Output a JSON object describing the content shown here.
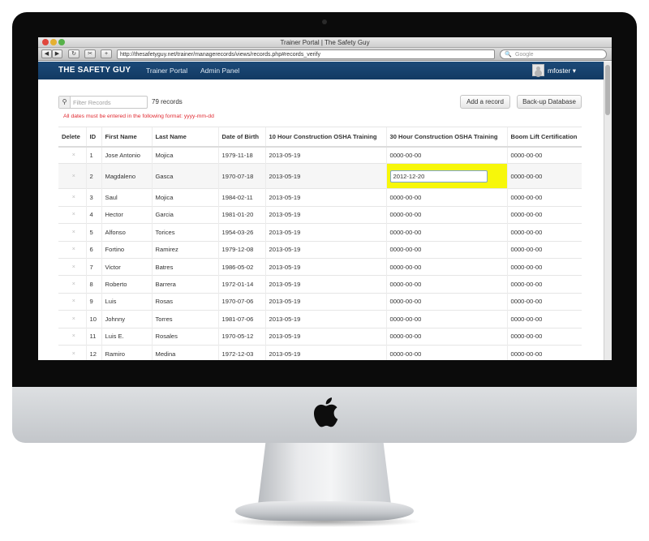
{
  "window": {
    "title": "Trainer Portal | The Safety Guy",
    "url": "http://thesafetyguy.net/trainer/managerecords/views/records.php#records_verify",
    "search_placeholder": "Google",
    "toolbar_buttons": [
      "◀",
      "▶",
      "↻",
      "✂",
      "+"
    ]
  },
  "navbar": {
    "brand": "THE SAFETY GUY",
    "links": [
      "Trainer Portal",
      "Admin Panel"
    ],
    "user": "mfoster",
    "brand_color": "#1c4a78"
  },
  "controls": {
    "filter_placeholder": "Filter Records",
    "record_count": "79 records",
    "add_record": "Add a record",
    "backup": "Back-up Database",
    "date_note": "All dates must be entered in the following format: yyyy-mm-dd"
  },
  "table": {
    "headers": [
      "Delete",
      "ID",
      "First Name",
      "Last Name",
      "Date of Birth",
      "10 Hour Construction OSHA Training",
      "30 Hour Construction OSHA Training",
      "Boom Lift Certification"
    ],
    "delete_glyph": "×",
    "rows": [
      {
        "id": "1",
        "first": "Jose Antonio",
        "last": "Mojica",
        "dob": "1979-11-18",
        "osha10": "2013-05-19",
        "osha30": "0000-00-00",
        "boom": "0000-00-00"
      },
      {
        "id": "2",
        "first": "Magdaleno",
        "last": "Gasca",
        "dob": "1970-07-18",
        "osha10": "2013-05-19",
        "osha30": "2012-12-20",
        "boom": "0000-00-00"
      },
      {
        "id": "3",
        "first": "Saul",
        "last": "Mojica",
        "dob": "1984-02-11",
        "osha10": "2013-05-19",
        "osha30": "0000-00-00",
        "boom": "0000-00-00"
      },
      {
        "id": "4",
        "first": "Hector",
        "last": "Garcia",
        "dob": "1981-01-20",
        "osha10": "2013-05-19",
        "osha30": "0000-00-00",
        "boom": "0000-00-00"
      },
      {
        "id": "5",
        "first": "Alfonso",
        "last": "Torices",
        "dob": "1954-03-26",
        "osha10": "2013-05-19",
        "osha30": "0000-00-00",
        "boom": "0000-00-00"
      },
      {
        "id": "6",
        "first": "Fortino",
        "last": "Ramirez",
        "dob": "1979-12-08",
        "osha10": "2013-05-19",
        "osha30": "0000-00-00",
        "boom": "0000-00-00"
      },
      {
        "id": "7",
        "first": "Victor",
        "last": "Batres",
        "dob": "1986-05-02",
        "osha10": "2013-05-19",
        "osha30": "0000-00-00",
        "boom": "0000-00-00"
      },
      {
        "id": "8",
        "first": "Roberto",
        "last": "Barrera",
        "dob": "1972-01-14",
        "osha10": "2013-05-19",
        "osha30": "0000-00-00",
        "boom": "0000-00-00"
      },
      {
        "id": "9",
        "first": "Luis",
        "last": "Rosas",
        "dob": "1970-07-06",
        "osha10": "2013-05-19",
        "osha30": "0000-00-00",
        "boom": "0000-00-00"
      },
      {
        "id": "10",
        "first": "Johnny",
        "last": "Torres",
        "dob": "1981-07-06",
        "osha10": "2013-05-19",
        "osha30": "0000-00-00",
        "boom": "0000-00-00"
      },
      {
        "id": "11",
        "first": "Luis E.",
        "last": "Rosales",
        "dob": "1970-05-12",
        "osha10": "2013-05-19",
        "osha30": "0000-00-00",
        "boom": "0000-00-00"
      },
      {
        "id": "12",
        "first": "Ramiro",
        "last": "Medina",
        "dob": "1972-12-03",
        "osha10": "2013-05-19",
        "osha30": "0000-00-00",
        "boom": "0000-00-00"
      }
    ],
    "editing_row_id": "2",
    "highlight_color": "#f7f70a"
  }
}
